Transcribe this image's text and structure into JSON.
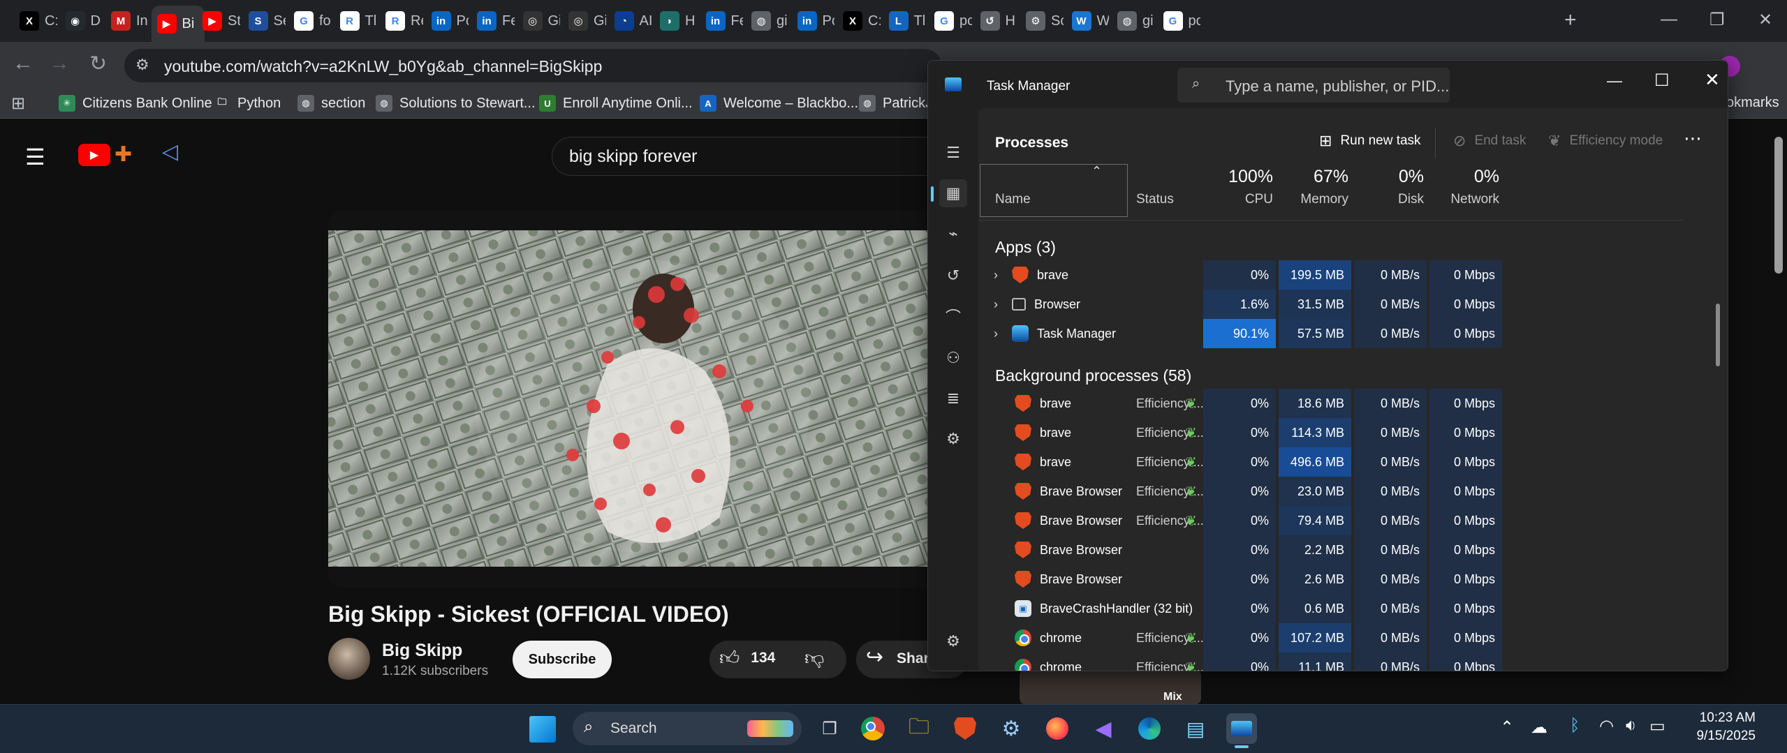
{
  "tabs": [
    {
      "label": "C:",
      "icon": "x-icon",
      "color": "#000000",
      "glyph": "X"
    },
    {
      "label": "D",
      "icon": "github-icon",
      "color": "#24292e",
      "glyph": "◉"
    },
    {
      "label": "In",
      "icon": "gmail-icon",
      "color": "#c5221f",
      "glyph": "M"
    },
    {
      "label": "Bi",
      "icon": "youtube-tab-icon",
      "color": "#ff0000",
      "glyph": "▶",
      "active": true
    },
    {
      "label": "St",
      "icon": "youtube-icon",
      "color": "#ff0000",
      "glyph": "▶"
    },
    {
      "label": "Se",
      "icon": "ssn-icon",
      "color": "#1f4e9a",
      "glyph": "S"
    },
    {
      "label": "fo",
      "icon": "google-icon",
      "color": "#ffffff",
      "glyph": "G"
    },
    {
      "label": "Tl",
      "icon": "r-icon",
      "color": "#ffffff",
      "glyph": "R"
    },
    {
      "label": "Re",
      "icon": "r-icon",
      "color": "#ffffff",
      "glyph": "R"
    },
    {
      "label": "Pc",
      "icon": "linkedin-icon",
      "color": "#0a66c2",
      "glyph": "in"
    },
    {
      "label": "Fe",
      "icon": "linkedin-icon",
      "color": "#0a66c2",
      "glyph": "in"
    },
    {
      "label": "Gi",
      "icon": "openai-icon",
      "color": "#333333",
      "glyph": "◎"
    },
    {
      "label": "Gi",
      "icon": "openai-icon",
      "color": "#333333",
      "glyph": "◎"
    },
    {
      "label": "AI",
      "icon": "meta-icon",
      "color": "#0b3d91",
      "glyph": "◔"
    },
    {
      "label": "H",
      "icon": "hugging-icon",
      "color": "#1d6f6a",
      "glyph": "◗"
    },
    {
      "label": "Fe",
      "icon": "linkedin-icon",
      "color": "#0a66c2",
      "glyph": "in"
    },
    {
      "label": "gi",
      "icon": "globe-icon",
      "color": "#5f6368",
      "glyph": "◍"
    },
    {
      "label": "Pc",
      "icon": "linkedin-icon",
      "color": "#0a66c2",
      "glyph": "in"
    },
    {
      "label": "C:",
      "icon": "x-icon",
      "color": "#000000",
      "glyph": "X"
    },
    {
      "label": "Tl",
      "icon": "l-icon",
      "color": "#1565c0",
      "glyph": "L"
    },
    {
      "label": "pc",
      "icon": "google-icon",
      "color": "#ffffff",
      "glyph": "G"
    },
    {
      "label": "H",
      "icon": "history-icon",
      "color": "#5f6368",
      "glyph": "↺"
    },
    {
      "label": "Sc",
      "icon": "settings-icon",
      "color": "#5f6368",
      "glyph": "⚙"
    },
    {
      "label": "W",
      "icon": "w-icon",
      "color": "#1976d2",
      "glyph": "W"
    },
    {
      "label": "gi",
      "icon": "globe-icon",
      "color": "#5f6368",
      "glyph": "◍"
    },
    {
      "label": "pc",
      "icon": "google-icon",
      "color": "#ffffff",
      "glyph": "G"
    }
  ],
  "url": "youtube.com/watch?v=a2KnLW_b0Yg&ab_channel=BigSkipp",
  "bookmarks": [
    {
      "label": "Citizens Bank Online",
      "icon": "citizens-icon",
      "color": "#2e8b57",
      "glyph": "✳"
    },
    {
      "label": "Python",
      "icon": "folder-icon",
      "color": "#35363a",
      "glyph": "🗀"
    },
    {
      "label": "section",
      "icon": "globe-icon",
      "color": "#5f6368",
      "glyph": "◍"
    },
    {
      "label": "Solutions to Stewart...",
      "icon": "globe-icon",
      "color": "#5f6368",
      "glyph": "◍"
    },
    {
      "label": "Enroll Anytime Onli...",
      "icon": "unh-icon",
      "color": "#2e7d32",
      "glyph": "U"
    },
    {
      "label": "Welcome – Blackbo...",
      "icon": "blackboard-icon",
      "color": "#1565c0",
      "glyph": "A"
    },
    {
      "label": "PatrickJ",
      "icon": "globe-icon",
      "color": "#5f6368",
      "glyph": "◍"
    }
  ],
  "bookmarks_overflow": "okmarks",
  "youtube": {
    "search_query": "big skipp forever",
    "video_title": "Big Skipp - Sickest (OFFICIAL VIDEO)",
    "channel": "Big Skipp",
    "subscribers": "1.12K subscribers",
    "subscribe": "Subscribe",
    "likes": "134",
    "share": "Share",
    "mix": "Mix"
  },
  "taskmanager": {
    "title": "Task Manager",
    "search_placeholder": "Type a name, publisher, or PID...",
    "page": "Processes",
    "run_new_task": "Run new task",
    "end_task": "End task",
    "efficiency_mode": "Efficiency mode",
    "columns": {
      "name": "Name",
      "status": "Status",
      "cpu_pct": "100%",
      "cpu": "CPU",
      "mem_pct": "67%",
      "memory": "Memory",
      "disk_pct": "0%",
      "disk": "Disk",
      "net_pct": "0%",
      "network": "Network"
    },
    "apps_header": "Apps (3)",
    "bg_header": "Background processes (58)",
    "apps": [
      {
        "name": "brave",
        "icon": "brave",
        "cpu": "0%",
        "mem": "199.5 MB",
        "disk": "0 MB/s",
        "net": "0 Mbps",
        "cpu_heat": 0.15,
        "mem_heat": 0.55
      },
      {
        "name": "Browser",
        "icon": "window",
        "cpu": "1.6%",
        "mem": "31.5 MB",
        "disk": "0 MB/s",
        "net": "0 Mbps",
        "cpu_heat": 0.3,
        "mem_heat": 0.25
      },
      {
        "name": "Task Manager",
        "icon": "taskmgr",
        "cpu": "90.1%",
        "mem": "57.5 MB",
        "disk": "0 MB/s",
        "net": "0 Mbps",
        "cpu_heat": 1.0,
        "mem_heat": 0.3
      }
    ],
    "efficiency_label": "Efficiency ...",
    "bg": [
      {
        "name": "brave",
        "icon": "brave",
        "status": true,
        "cpu": "0%",
        "mem": "18.6 MB",
        "disk": "0 MB/s",
        "net": "0 Mbps",
        "mem_heat": 0.2
      },
      {
        "name": "brave",
        "icon": "brave",
        "status": true,
        "cpu": "0%",
        "mem": "114.3 MB",
        "disk": "0 MB/s",
        "net": "0 Mbps",
        "mem_heat": 0.45
      },
      {
        "name": "brave",
        "icon": "brave",
        "status": true,
        "cpu": "0%",
        "mem": "496.6 MB",
        "disk": "0 MB/s",
        "net": "0 Mbps",
        "mem_heat": 0.7
      },
      {
        "name": "Brave Browser",
        "icon": "brave",
        "status": true,
        "cpu": "0%",
        "mem": "23.0 MB",
        "disk": "0 MB/s",
        "net": "0 Mbps",
        "mem_heat": 0.2
      },
      {
        "name": "Brave Browser",
        "icon": "brave",
        "status": true,
        "cpu": "0%",
        "mem": "79.4 MB",
        "disk": "0 MB/s",
        "net": "0 Mbps",
        "mem_heat": 0.3
      },
      {
        "name": "Brave Browser",
        "icon": "brave",
        "status": false,
        "cpu": "0%",
        "mem": "2.2 MB",
        "disk": "0 MB/s",
        "net": "0 Mbps",
        "mem_heat": 0.15
      },
      {
        "name": "Brave Browser",
        "icon": "brave",
        "status": false,
        "cpu": "0%",
        "mem": "2.6 MB",
        "disk": "0 MB/s",
        "net": "0 Mbps",
        "mem_heat": 0.15
      },
      {
        "name": "BraveCrashHandler (32 bit)",
        "icon": "crash",
        "status": false,
        "cpu": "0%",
        "mem": "0.6 MB",
        "disk": "0 MB/s",
        "net": "0 Mbps",
        "mem_heat": 0.15
      },
      {
        "name": "chrome",
        "icon": "chrome",
        "status": true,
        "cpu": "0%",
        "mem": "107.2 MB",
        "disk": "0 MB/s",
        "net": "0 Mbps",
        "mem_heat": 0.45
      },
      {
        "name": "chrome",
        "icon": "chrome",
        "status": true,
        "cpu": "0%",
        "mem": "11.1 MB",
        "disk": "0 MB/s",
        "net": "0 Mbps",
        "mem_heat": 0.2
      }
    ]
  },
  "taskbar": {
    "search": "Search",
    "time": "10:23 AM",
    "date": "9/15/2025"
  }
}
